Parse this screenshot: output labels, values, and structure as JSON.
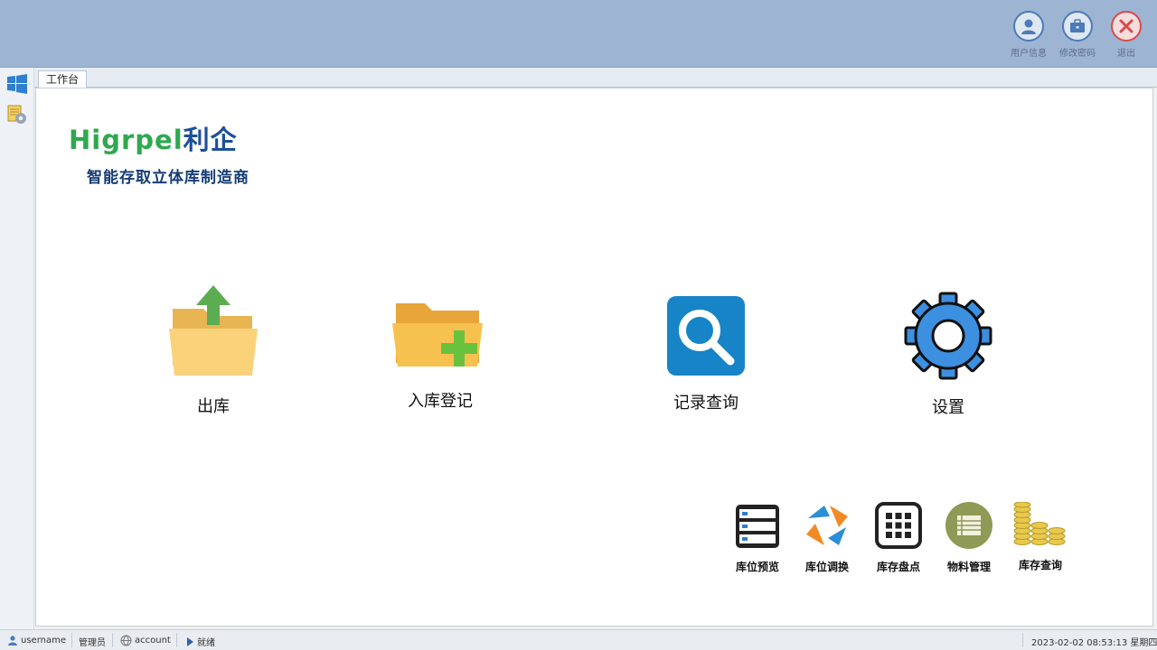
{
  "header": {
    "actions": [
      {
        "label": "用户信息",
        "icon": "user-icon"
      },
      {
        "label": "修改密码",
        "icon": "briefcase-icon"
      },
      {
        "label": "退出",
        "icon": "close-icon"
      }
    ]
  },
  "sidebar": {
    "icons": [
      "windows-icon",
      "database-settings-icon"
    ]
  },
  "tabs": [
    {
      "label": "工作台"
    }
  ],
  "logo": {
    "brand_latin": "Higrpel",
    "brand_cn": "利企",
    "tagline": "智能存取立体库制造商"
  },
  "main_actions": [
    {
      "label": "出库",
      "icon": "folder-upload-icon"
    },
    {
      "label": "入库登记",
      "icon": "folder-add-icon"
    },
    {
      "label": "记录查询",
      "icon": "search-icon"
    },
    {
      "label": "设置",
      "icon": "gear-icon"
    }
  ],
  "quick_actions": [
    {
      "label": "库位预览",
      "icon": "server-list-icon"
    },
    {
      "label": "库位调换",
      "icon": "swap-cycle-icon"
    },
    {
      "label": "库存盘点",
      "icon": "grid-icon"
    },
    {
      "label": "物料管理",
      "icon": "list-icon"
    },
    {
      "label": "库存查询",
      "icon": "coins-icon"
    }
  ],
  "statusbar": {
    "username": "username",
    "role": "管理员",
    "account": "account",
    "status": "就绪",
    "datetime": "2023-02-02 08:53:13 星期四"
  },
  "colors": {
    "topbar": "#9db4d3",
    "brand_blue": "#1d4f9a",
    "brand_green": "#2fa84f",
    "search_blue": "#1784c7",
    "gear_blue": "#3d8fe0"
  }
}
